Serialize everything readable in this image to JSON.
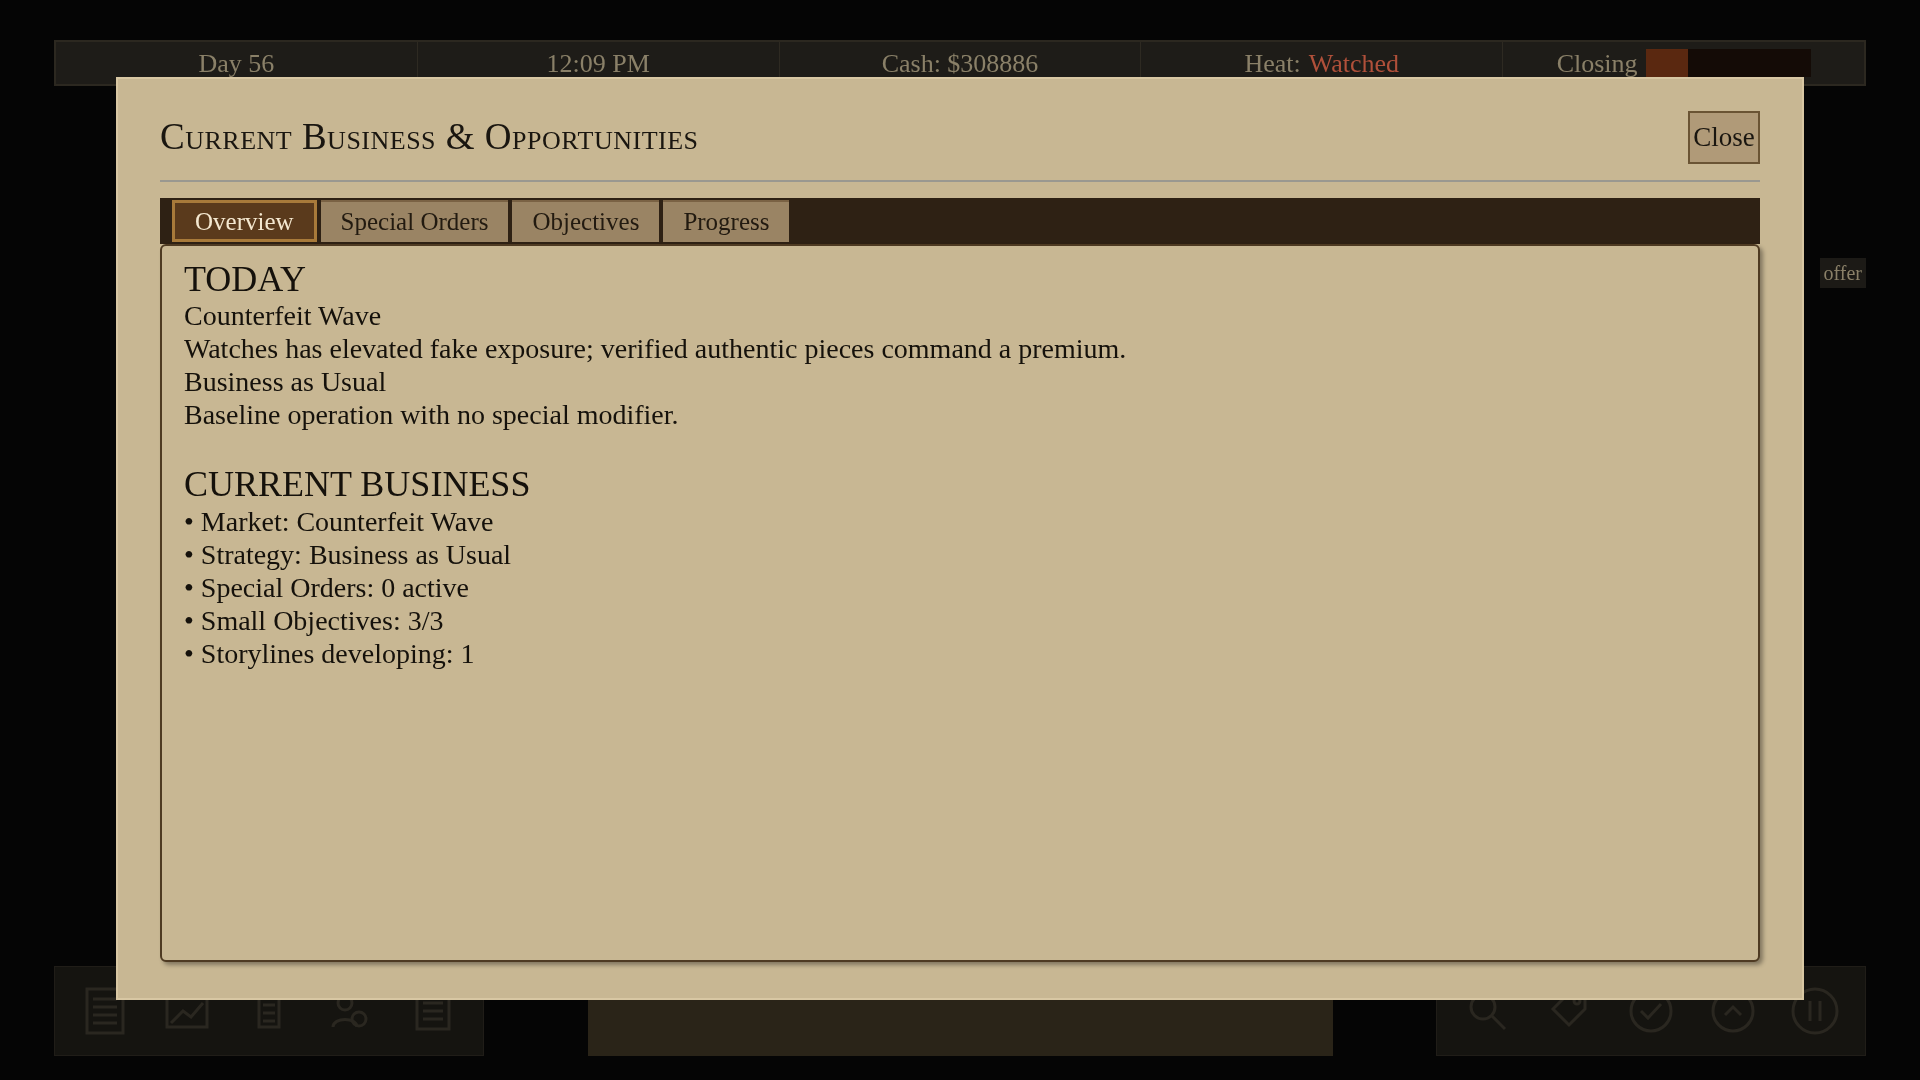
{
  "status_bar": {
    "day": "Day 56",
    "time": "12:09 PM",
    "cash": "Cash: $308886",
    "heat_label": "Heat:",
    "heat_value": "Watched",
    "closing_label": "Closing",
    "closing_meter": {
      "level": 0.26
    }
  },
  "background_text": "offer",
  "dialog": {
    "title": "Current Business & Opportunities",
    "close_label": "Close",
    "tabs": [
      {
        "label": "Overview",
        "selected": true
      },
      {
        "label": "Special Orders",
        "selected": false
      },
      {
        "label": "Objectives",
        "selected": false
      },
      {
        "label": "Progress",
        "selected": false
      }
    ],
    "sections": [
      {
        "heading": "TODAY",
        "lines": [
          "Counterfeit Wave",
          "Watches has elevated fake exposure; verified authentic pieces command a premium.",
          "Business as Usual",
          "Baseline operation with no special modifier."
        ]
      },
      {
        "heading": "CURRENT BUSINESS",
        "lines": [
          "• Market: Counterfeit Wave",
          "• Strategy: Business as Usual",
          "• Special Orders: 0 active",
          "• Small Objectives: 3/3",
          "• Storylines developing: 1"
        ]
      }
    ]
  }
}
